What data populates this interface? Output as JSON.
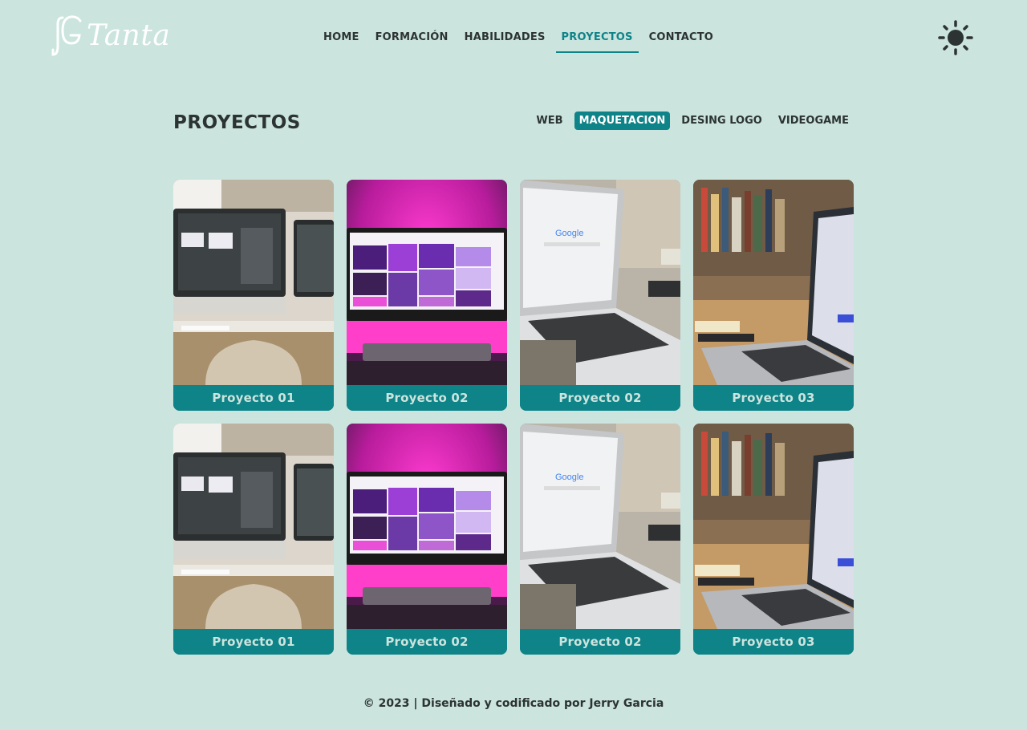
{
  "header": {
    "logo_text": "Tanta",
    "nav": [
      {
        "label": "HOME",
        "active": false
      },
      {
        "label": "FORMACIÓN",
        "active": false
      },
      {
        "label": "HABILIDADES",
        "active": false
      },
      {
        "label": "PROYECTOS",
        "active": true
      },
      {
        "label": "CONTACTO",
        "active": false
      }
    ],
    "theme_icon": "sun-icon"
  },
  "projects": {
    "title": "PROYECTOS",
    "filters": [
      {
        "label": "WEB",
        "active": false
      },
      {
        "label": "MAQUETACION",
        "active": true
      },
      {
        "label": "DESING LOGO",
        "active": false
      },
      {
        "label": "VIDEOGAME",
        "active": false
      }
    ],
    "cards": [
      {
        "title": "Proyecto 01",
        "image": "desk-imac-photo"
      },
      {
        "title": "Proyecto 02",
        "image": "pink-imac-photo"
      },
      {
        "title": "Proyecto 02",
        "image": "macbook-google-photo"
      },
      {
        "title": "Proyecto 03",
        "image": "laptop-bookshelf-photo"
      },
      {
        "title": "Proyecto 01",
        "image": "desk-imac-photo"
      },
      {
        "title": "Proyecto 02",
        "image": "pink-imac-photo"
      },
      {
        "title": "Proyecto 02",
        "image": "macbook-google-photo"
      },
      {
        "title": "Proyecto 03",
        "image": "laptop-bookshelf-photo"
      }
    ]
  },
  "footer": {
    "text": "© 2023 | Diseñado y codificado por Jerry Garcia"
  },
  "colors": {
    "background": "#cbe4de",
    "accent": "#0e8388",
    "text": "#2c3333"
  }
}
